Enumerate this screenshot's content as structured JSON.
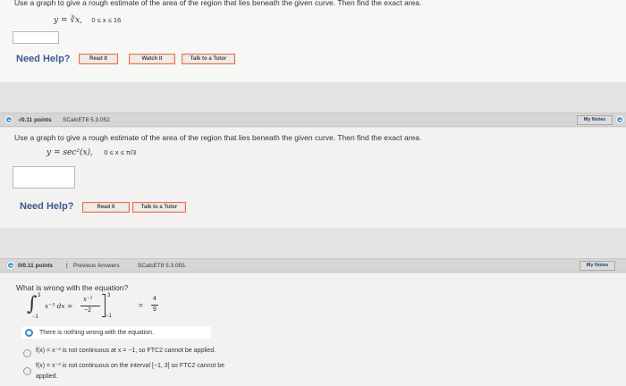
{
  "q1": {
    "prompt": "Use a graph to give a rough estimate of the area of the region that lies beneath the given curve. Then find the exact area.",
    "equation": "y = ∛x,",
    "range": "0 ≤ x ≤ 16",
    "need_help": "Need Help?",
    "buttons": [
      "Read It",
      "Watch It",
      "Talk to a Tutor"
    ]
  },
  "q2": {
    "points": "-/0.11 points",
    "code": "SCalcET8 5.3.052.",
    "my_notes": "My Notes",
    "prompt": "Use a graph to give a rough estimate of the area of the region that lies beneath the given curve. Then find the exact area.",
    "equation": "y = sec²(x),",
    "range": "0 ≤ x ≤ π/3",
    "need_help": "Need Help?",
    "buttons": [
      "Read It",
      "Talk to a Tutor"
    ]
  },
  "q3": {
    "points": "0/0.11 points",
    "separator": "|",
    "previous": "Previous Answers",
    "code": "SCalcET8 5.3.055.",
    "my_notes": "My Notes",
    "prompt": "What is wrong with the equation?",
    "integral_upper": "3",
    "integral_lower": "−1",
    "integrand": "x⁻³ dx =",
    "frac_num": "x⁻²",
    "frac_den": "−2",
    "bracket_upper": "3",
    "bracket_lower": "−1",
    "equals": "=",
    "result_num": "4",
    "result_den": "9",
    "choices": [
      "There is nothing wrong with the equation.",
      "f(x) = x⁻³ is not continuous at x = −1, so FTC2 cannot be applied.",
      "f(x) = x⁻³ is not continuous on the interval [−1, 3] so FTC2 cannot be",
      "applied."
    ]
  }
}
